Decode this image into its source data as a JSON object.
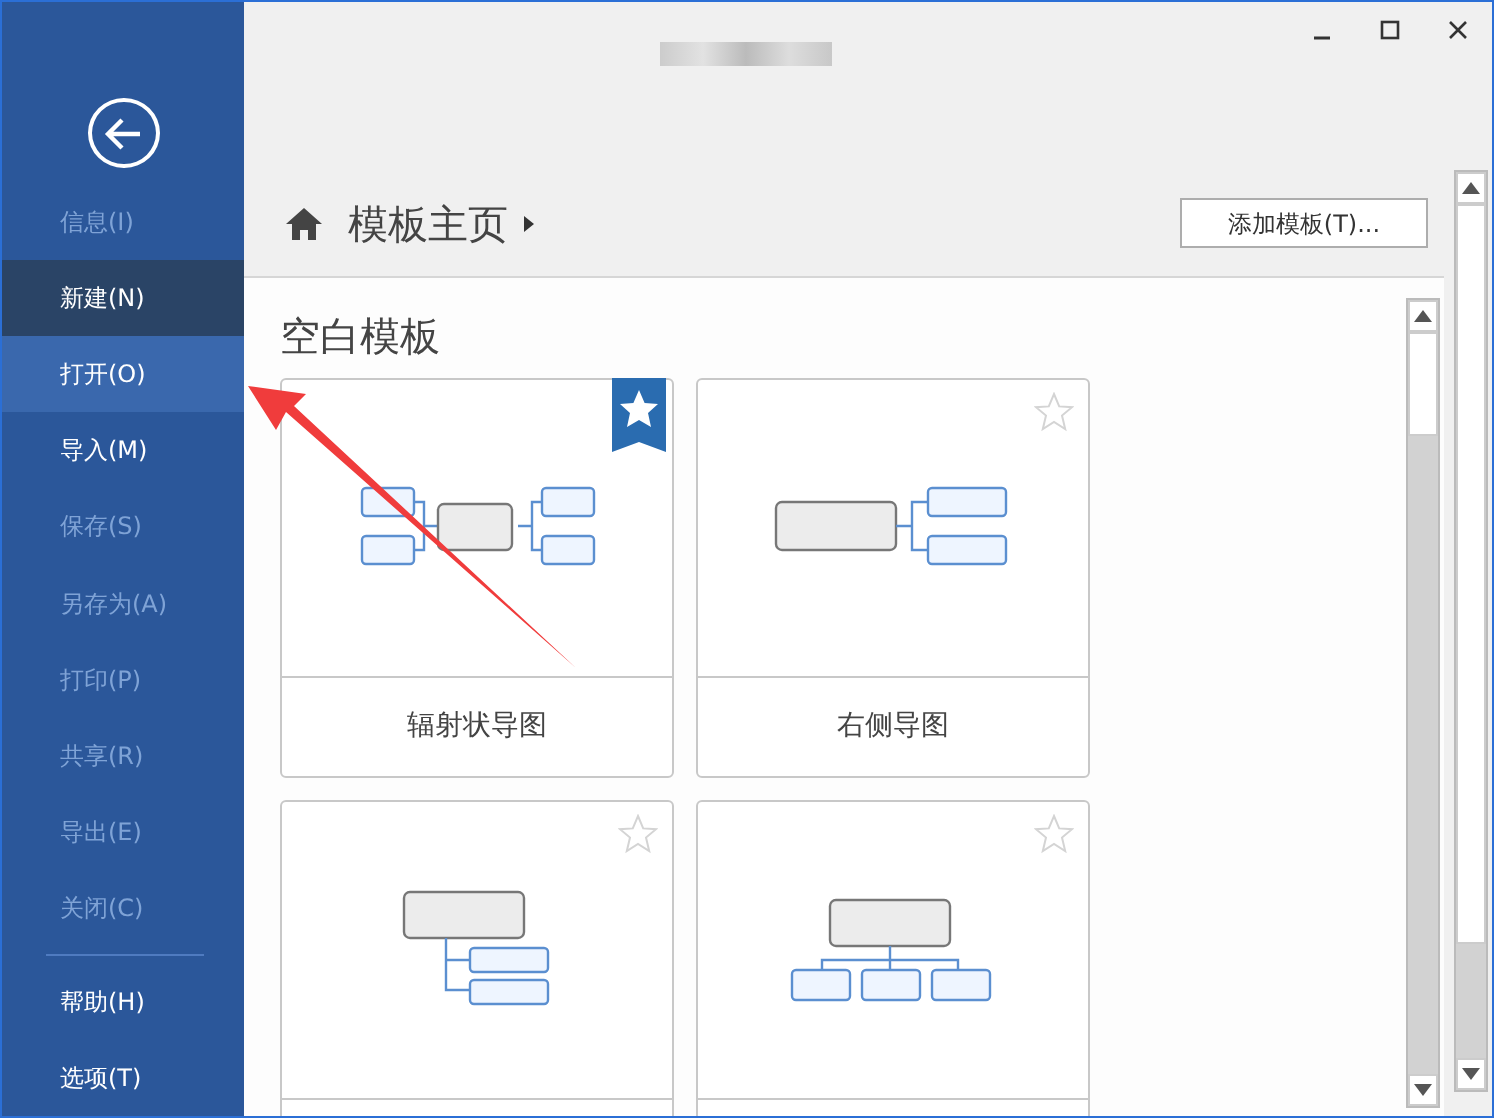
{
  "sidebar": {
    "menu": [
      {
        "label": "信息(I)",
        "disabled": true,
        "selected": false,
        "highlighted": false
      },
      {
        "label": "新建(N)",
        "disabled": false,
        "selected": true,
        "highlighted": false
      },
      {
        "label": "打开(O)",
        "disabled": false,
        "selected": false,
        "highlighted": true
      },
      {
        "label": "导入(M)",
        "disabled": false,
        "selected": false,
        "highlighted": false
      },
      {
        "label": "保存(S)",
        "disabled": true,
        "selected": false,
        "highlighted": false
      },
      {
        "label": "另存为(A)",
        "disabled": true,
        "selected": false,
        "highlighted": false
      },
      {
        "label": "打印(P)",
        "disabled": true,
        "selected": false,
        "highlighted": false
      },
      {
        "label": "共享(R)",
        "disabled": true,
        "selected": false,
        "highlighted": false
      },
      {
        "label": "导出(E)",
        "disabled": true,
        "selected": false,
        "highlighted": false
      },
      {
        "label": "关闭(C)",
        "disabled": true,
        "selected": false,
        "highlighted": false
      }
    ],
    "bottom_menu": [
      {
        "label": "帮助(H)",
        "disabled": false,
        "selected": false,
        "highlighted": false
      },
      {
        "label": "选项(T)",
        "disabled": false,
        "selected": false,
        "highlighted": false
      }
    ]
  },
  "breadcrumb": {
    "title": "模板主页"
  },
  "add_button": "添加模板(T)...",
  "section_title": "空白模板",
  "templates": [
    {
      "label": "辐射状导图",
      "starred": true,
      "kind": "radial"
    },
    {
      "label": "右侧导图",
      "starred": false,
      "kind": "right"
    },
    {
      "starred": false,
      "kind": "tree"
    },
    {
      "starred": false,
      "kind": "org"
    }
  ]
}
